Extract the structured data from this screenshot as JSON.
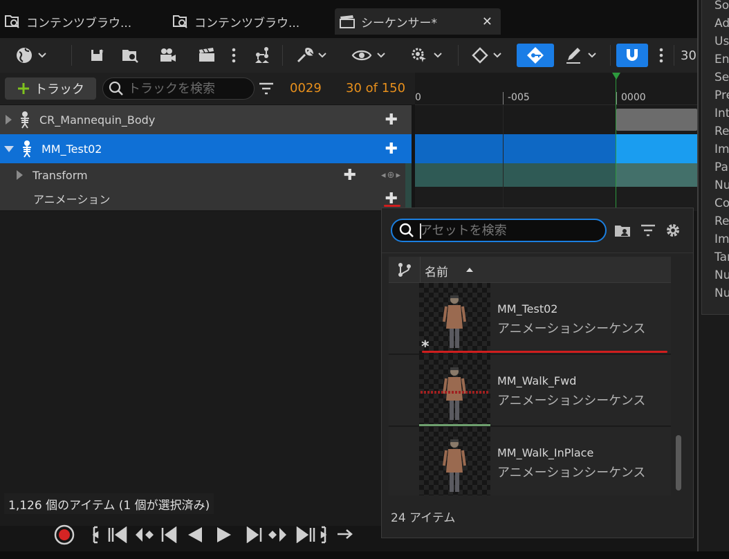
{
  "tabs": [
    {
      "label": "コンテンツブラウ...",
      "icon": "content-browser-icon"
    },
    {
      "label": "コンテンツブラウ...",
      "icon": "content-browser-icon"
    },
    {
      "label": "シーケンサー*",
      "icon": "clapper-icon",
      "close": "✕"
    }
  ],
  "toolbar": {
    "frame_rate_partial": "30"
  },
  "track_header": {
    "add_track_label": "トラック",
    "search_placeholder": "トラックを検索",
    "current_frame": "0029",
    "frame_range": "30 of 150"
  },
  "outliner": {
    "rows": [
      {
        "label": "CR_Mannequin_Body"
      },
      {
        "label": "MM_Test02"
      },
      {
        "label": "Transform"
      },
      {
        "label": "アニメーション"
      }
    ]
  },
  "timeline": {
    "ticks": [
      "0",
      "-005",
      "0000"
    ],
    "colors": {
      "playhead": "#2d9a3d",
      "selected_lane": "#0e68c4"
    }
  },
  "details": {
    "labels": [
      "Sou",
      "Adc",
      "Use",
      "Ena",
      "Sec",
      "Pre",
      "Inte",
      "Ret",
      "Imp",
      "Par",
      "Nur",
      "Cor",
      "Ret",
      "Imp",
      "Tar",
      "Nur",
      "Nur"
    ]
  },
  "picker": {
    "search_placeholder": "アセットを検索",
    "column_name": "名前",
    "assets": [
      {
        "name": "MM_Test02",
        "type": "アニメーションシーケンス"
      },
      {
        "name": "MM_Walk_Fwd",
        "type": "アニメーションシーケンス"
      },
      {
        "name": "MM_Walk_InPlace",
        "type": "アニメーションシーケンス"
      }
    ],
    "item_count": "24 アイテム",
    "dirty_marker": "*"
  },
  "status": {
    "items_text": "1,126 個のアイテム (1 個が選択済み)"
  }
}
